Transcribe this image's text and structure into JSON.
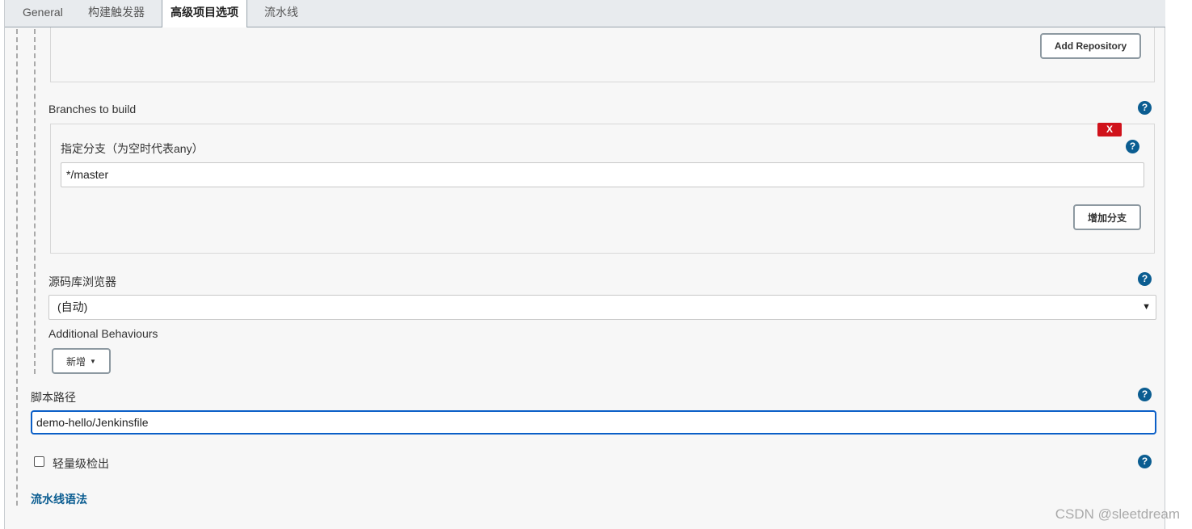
{
  "tabs": [
    {
      "label": "General"
    },
    {
      "label": "构建触发器"
    },
    {
      "label": "高级项目选项",
      "active": true
    },
    {
      "label": "流水线"
    }
  ],
  "repository": {
    "add_repository_label": "Add Repository"
  },
  "branches": {
    "title": "Branches to build",
    "branch_label": "指定分支（为空时代表any）",
    "branch_value": "*/master",
    "delete_label": "X",
    "add_branch_label": "增加分支"
  },
  "browser": {
    "title": "源码库浏览器",
    "selected": "(自动)"
  },
  "behaviours": {
    "title": "Additional Behaviours",
    "add_label": "新增"
  },
  "script_path": {
    "title": "脚本路径",
    "value": "demo-hello/Jenkinsfile"
  },
  "lightweight": {
    "label": "轻量级检出",
    "checked": false
  },
  "pipeline_syntax_link": "流水线语法",
  "help_icon": "?",
  "watermark": "CSDN @sleetdream",
  "colors": {
    "accent": "#0b5d91",
    "danger": "#d0121b",
    "focus": "#0b5fc7"
  }
}
